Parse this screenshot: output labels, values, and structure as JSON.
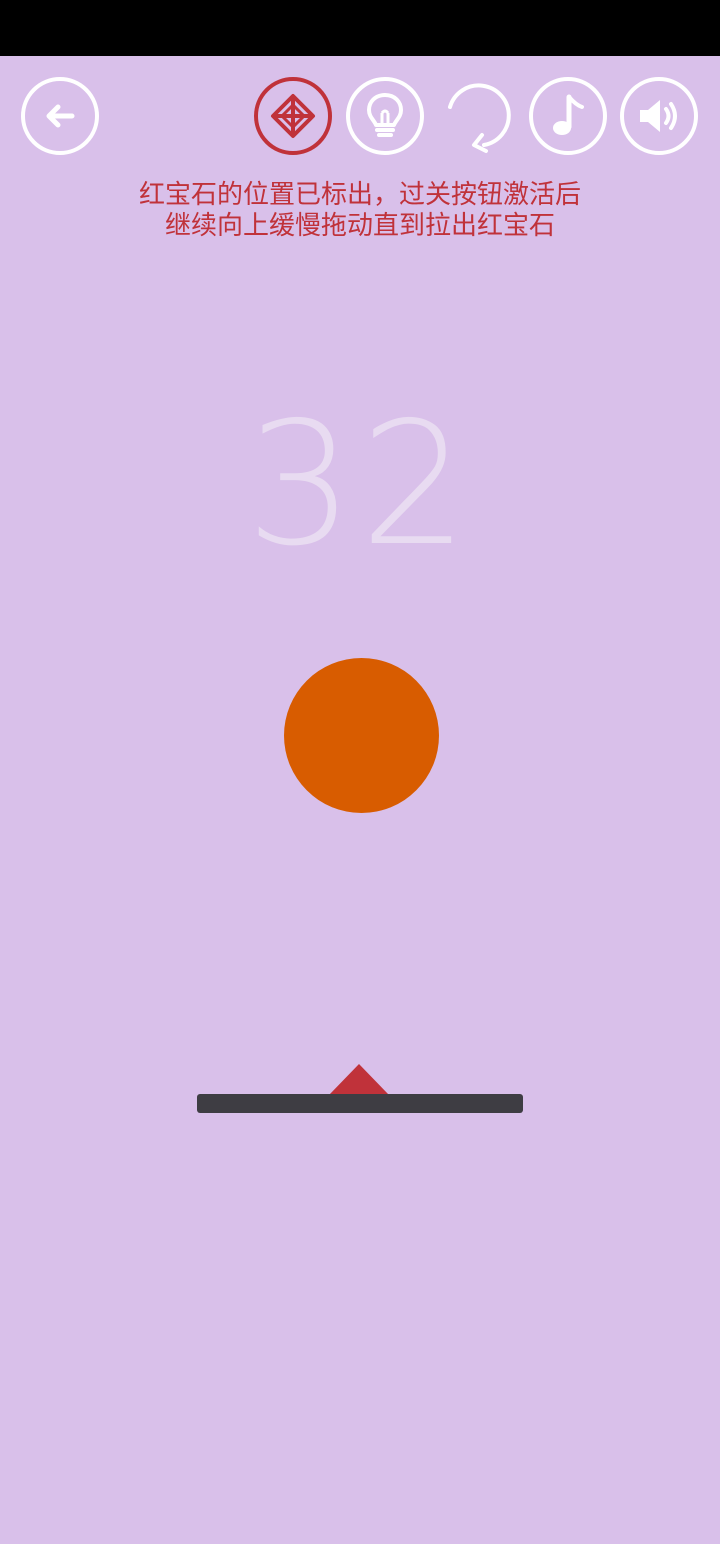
{
  "instruction": {
    "line1": "红宝石的位置已标出，过关按钮激活后",
    "line2": "继续向上缓慢拖动直到拉出红宝石"
  },
  "score": "32",
  "toolbar": {
    "back_icon": "back-arrow-icon",
    "gem_icon": "gem-locator-icon",
    "hint_icon": "lightbulb-icon",
    "restart_icon": "restart-icon",
    "music_icon": "music-note-icon",
    "sound_icon": "speaker-icon"
  },
  "colors": {
    "background": "#d9c0ea",
    "accent_red": "#c0323a",
    "ball": "#d85c00",
    "paddle": "#3e3d43",
    "score_text": "#e8dbf1"
  }
}
